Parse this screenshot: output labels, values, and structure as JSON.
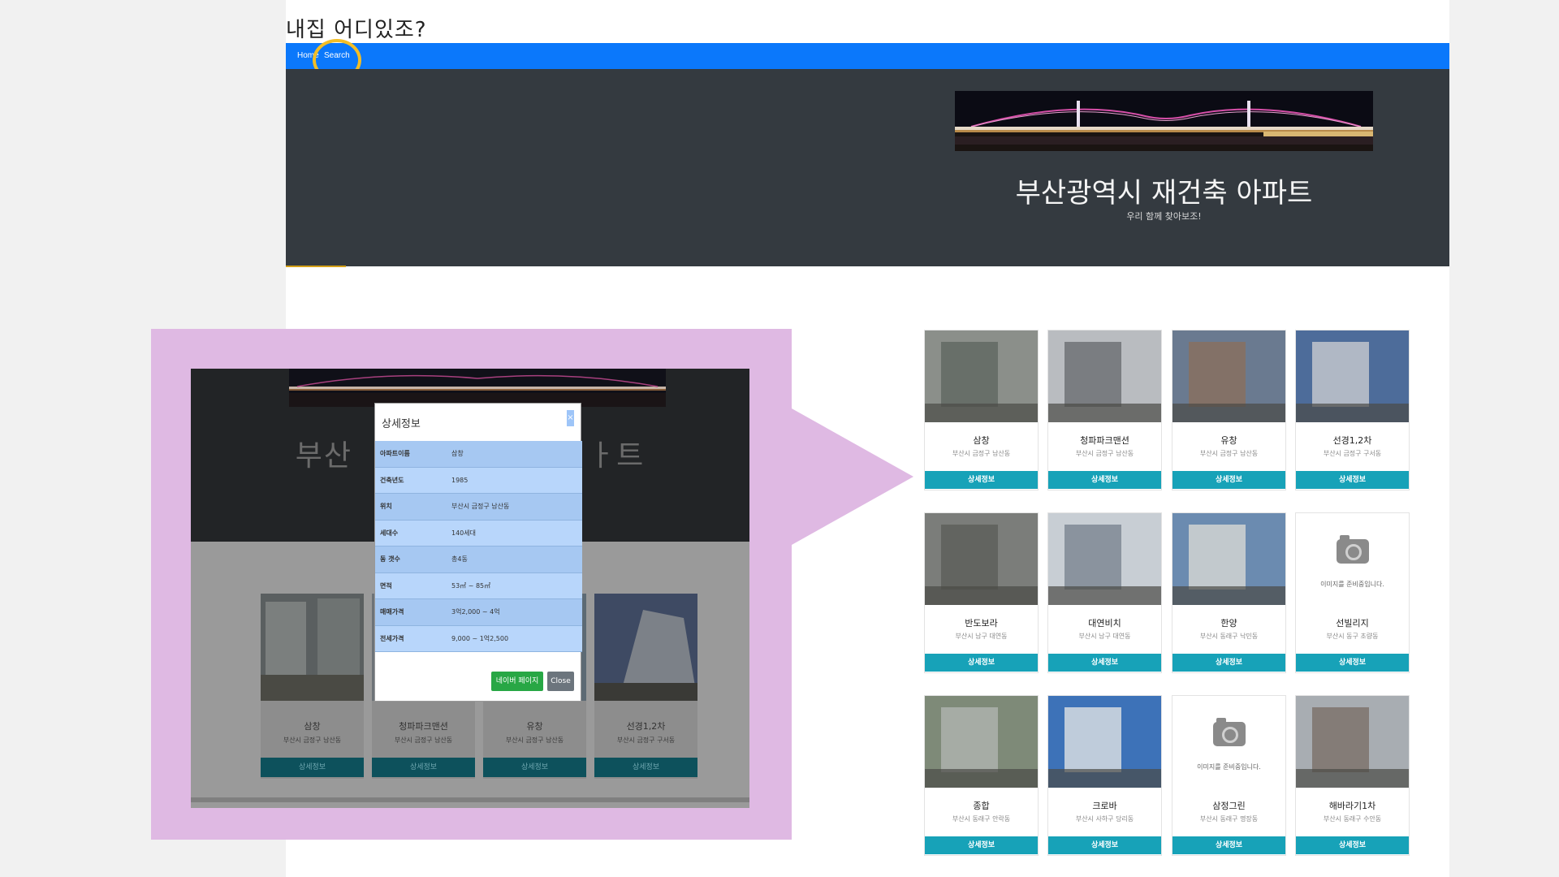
{
  "site": {
    "title": "내집 어디있조?"
  },
  "nav": {
    "home": "Home",
    "search": "Search"
  },
  "hero": {
    "title": "부산광역시 재건축 아파트",
    "subtitle": "우리 함께 찾아보조!"
  },
  "cards": [
    {
      "name": "삼창",
      "addr": "부산시 금정구 남산동",
      "button": "상세정보",
      "photo": "photo"
    },
    {
      "name": "청파파크맨션",
      "addr": "부산시 금정구 남산동",
      "button": "상세정보",
      "photo": "photo"
    },
    {
      "name": "유창",
      "addr": "부산시 금정구 남산동",
      "button": "상세정보",
      "photo": "photo"
    },
    {
      "name": "선경1,2차",
      "addr": "부산시 금정구 구서동",
      "button": "상세정보",
      "photo": "photo"
    },
    {
      "name": "반도보라",
      "addr": "부산시 남구 대연동",
      "button": "상세정보",
      "photo": "photo"
    },
    {
      "name": "대연비치",
      "addr": "부산시 남구 대연동",
      "button": "상세정보",
      "photo": "photo"
    },
    {
      "name": "한양",
      "addr": "부산시 동래구 낙민동",
      "button": "상세정보",
      "photo": "photo"
    },
    {
      "name": "선빌리지",
      "addr": "부산시 동구 초량동",
      "button": "상세정보",
      "photo": "placeholder",
      "placeholder_text": "이미지를 준비중입니다."
    },
    {
      "name": "종합",
      "addr": "부산시 동래구 안락동",
      "button": "상세정보",
      "photo": "photo"
    },
    {
      "name": "크로바",
      "addr": "부산시 사하구 당리동",
      "button": "상세정보",
      "photo": "photo"
    },
    {
      "name": "삼정그린",
      "addr": "부산시 동래구 명장동",
      "button": "상세정보",
      "photo": "placeholder",
      "placeholder_text": "이미지를 준비중입니다."
    },
    {
      "name": "해바라기1차",
      "addr": "부산시 동래구 수안동",
      "button": "상세정보",
      "photo": "photo"
    }
  ],
  "inset": {
    "title_left": "부산",
    "title_right": "ㅏ트",
    "cards": [
      {
        "name": "삼창",
        "addr": "부산시 금정구 남산동",
        "button": "상세정보"
      },
      {
        "name": "청파파크맨션",
        "addr": "부산시 금정구 남산동",
        "button": "상세정보"
      },
      {
        "name": "유창",
        "addr": "부산시 금정구 남산동",
        "button": "상세정보"
      },
      {
        "name": "선경1,2차",
        "addr": "부산시 금정구 구서동",
        "button": "상세정보"
      }
    ]
  },
  "modal": {
    "title": "상세정보",
    "close_x": "×",
    "rows": [
      {
        "k": "아파트이름",
        "v": "삼창"
      },
      {
        "k": "건축년도",
        "v": "1985"
      },
      {
        "k": "위치",
        "v": "부산시 금정구 남산동"
      },
      {
        "k": "세대수",
        "v": "140세대"
      },
      {
        "k": "동 갯수",
        "v": "총4동"
      },
      {
        "k": "면적",
        "v": "53㎡ ~ 85㎡"
      },
      {
        "k": "매매가격",
        "v": "3억2,000 ~ 4억"
      },
      {
        "k": "전세가격",
        "v": "9,000 ~ 1억2,500"
      }
    ],
    "naver_button": "네이버 페이지",
    "close_button": "Close"
  },
  "colors": {
    "navbar": "#0b78fb",
    "hero_bg": "#343a40",
    "card_button": "#17a2b8",
    "highlight": "#dfb9e3",
    "search_ring": "#f3be25"
  }
}
